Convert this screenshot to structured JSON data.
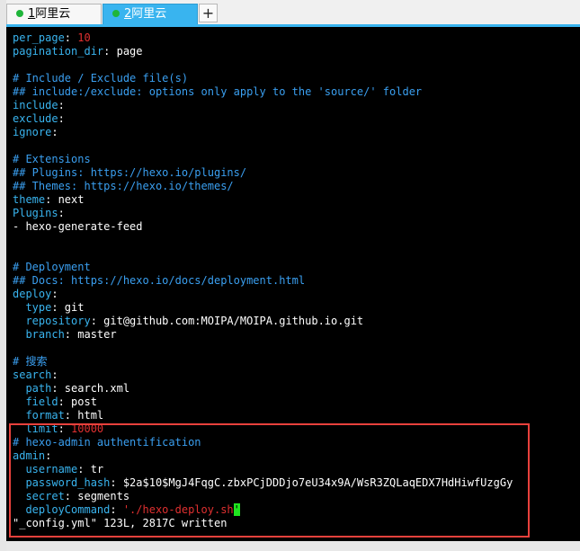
{
  "tabs": [
    {
      "num": "1",
      "label": "阿里云",
      "active": false
    },
    {
      "num": "2",
      "label": "阿里云",
      "active": true
    }
  ],
  "add_tab_label": "+",
  "terminal": {
    "lines": [
      [
        {
          "t": "per_page",
          "c": "k"
        },
        {
          "t": ": ",
          "c": "v"
        },
        {
          "t": "10",
          "c": "r"
        }
      ],
      [
        {
          "t": "pagination_dir",
          "c": "k"
        },
        {
          "t": ": page",
          "c": "v"
        }
      ],
      [],
      [
        {
          "t": "# Include / Exclude file(s)",
          "c": "c"
        }
      ],
      [
        {
          "t": "## include:/exclude: options only apply to the 'source/' folder",
          "c": "c"
        }
      ],
      [
        {
          "t": "include",
          "c": "k"
        },
        {
          "t": ":",
          "c": "v"
        }
      ],
      [
        {
          "t": "exclude",
          "c": "k"
        },
        {
          "t": ":",
          "c": "v"
        }
      ],
      [
        {
          "t": "ignore",
          "c": "k"
        },
        {
          "t": ":",
          "c": "v"
        }
      ],
      [],
      [
        {
          "t": "# Extensions",
          "c": "c"
        }
      ],
      [
        {
          "t": "## Plugins: https://hexo.io/plugins/",
          "c": "c"
        }
      ],
      [
        {
          "t": "## Themes: https://hexo.io/themes/",
          "c": "c"
        }
      ],
      [
        {
          "t": "theme",
          "c": "k"
        },
        {
          "t": ": next",
          "c": "v"
        }
      ],
      [
        {
          "t": "Plugins",
          "c": "k"
        },
        {
          "t": ":",
          "c": "v"
        }
      ],
      [
        {
          "t": "- hexo-generate-feed",
          "c": "v"
        }
      ],
      [],
      [],
      [
        {
          "t": "# Deployment",
          "c": "c"
        }
      ],
      [
        {
          "t": "## Docs: https://hexo.io/docs/deployment.html",
          "c": "c"
        }
      ],
      [
        {
          "t": "deploy",
          "c": "k"
        },
        {
          "t": ":",
          "c": "v"
        }
      ],
      [
        {
          "t": "  type",
          "c": "k"
        },
        {
          "t": ": git",
          "c": "v"
        }
      ],
      [
        {
          "t": "  repository",
          "c": "k"
        },
        {
          "t": ": git@github.com:MOIPA/MOIPA.github.io.git",
          "c": "v"
        }
      ],
      [
        {
          "t": "  branch",
          "c": "k"
        },
        {
          "t": ": master",
          "c": "v"
        }
      ],
      [],
      [
        {
          "t": "# 搜索",
          "c": "c"
        }
      ],
      [
        {
          "t": "search",
          "c": "k"
        },
        {
          "t": ":",
          "c": "v"
        }
      ],
      [
        {
          "t": "  path",
          "c": "k"
        },
        {
          "t": ": search.xml",
          "c": "v"
        }
      ],
      [
        {
          "t": "  field",
          "c": "k"
        },
        {
          "t": ": post",
          "c": "v"
        }
      ],
      [
        {
          "t": "  format",
          "c": "k"
        },
        {
          "t": ": html",
          "c": "v"
        }
      ],
      [
        {
          "t": "  limit",
          "c": "k"
        },
        {
          "t": ": ",
          "c": "v"
        },
        {
          "t": "10000",
          "c": "r"
        }
      ],
      [
        {
          "t": "# hexo-admin authentification",
          "c": "c"
        }
      ],
      [
        {
          "t": "admin",
          "c": "k"
        },
        {
          "t": ":",
          "c": "v"
        }
      ],
      [
        {
          "t": "  username",
          "c": "k"
        },
        {
          "t": ": tr",
          "c": "v"
        }
      ],
      [
        {
          "t": "  password_hash",
          "c": "k"
        },
        {
          "t": ": $2a$10$MgJ4FqgC.zbxPCjDDDjo7eU34x9A/WsR3ZQLaqEDX7HdHiwfUzgGy",
          "c": "v"
        }
      ],
      [
        {
          "t": "  secret",
          "c": "k"
        },
        {
          "t": ": segments",
          "c": "v"
        }
      ],
      [
        {
          "t": "  deployCommand",
          "c": "k"
        },
        {
          "t": ": ",
          "c": "v"
        },
        {
          "t": "'./hexo-deploy.sh",
          "c": "r"
        },
        {
          "t": "'",
          "c": "cursor"
        }
      ],
      [
        {
          "t": "\"_config.yml\" 123L, 2817C written",
          "c": "v"
        }
      ]
    ]
  },
  "colors": {
    "tab_active": "#39b4ef",
    "terminal_bg": "#000000",
    "key": "#39b4ef",
    "comment": "#3a9ff0",
    "value": "#ffffff",
    "number_string": "#e03030",
    "cursor": "#1fe31f",
    "highlight_border": "#e8413c"
  }
}
